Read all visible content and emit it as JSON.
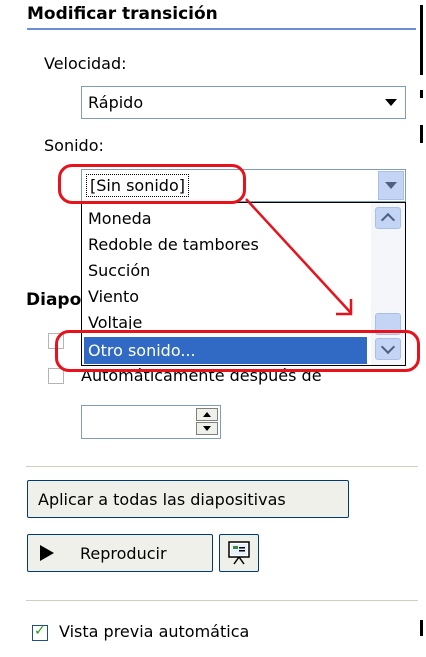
{
  "panel": {
    "title": "Modificar transición",
    "speed_label": "Velocidad:",
    "speed_value": "Rápido",
    "sound_label": "Sonido:",
    "sound_value": "[Sin sonido]",
    "sound_options": [
      "Moneda",
      "Redoble de tambores",
      "Succión",
      "Viento",
      "Voltaje"
    ],
    "sound_selected_option": "Otro sonido...",
    "advance_section": "Diapo",
    "auto_after_label": "Automáticamente después de",
    "apply_all_label": "Aplicar a todas las diapositivas",
    "play_label": "Reproducir",
    "autopreview_label": "Vista previa automática",
    "autopreview_checked": "✓"
  },
  "colors": {
    "annotation_red": "#e8121b",
    "selection_blue": "#316ac5",
    "scroll_blue": "#c3d4f5"
  },
  "icons": [
    "chevron-down-icon",
    "scroll-up-icon",
    "scroll-down-icon",
    "play-icon",
    "slide-show-icon",
    "check-icon",
    "spin-up-icon",
    "spin-down-icon"
  ]
}
